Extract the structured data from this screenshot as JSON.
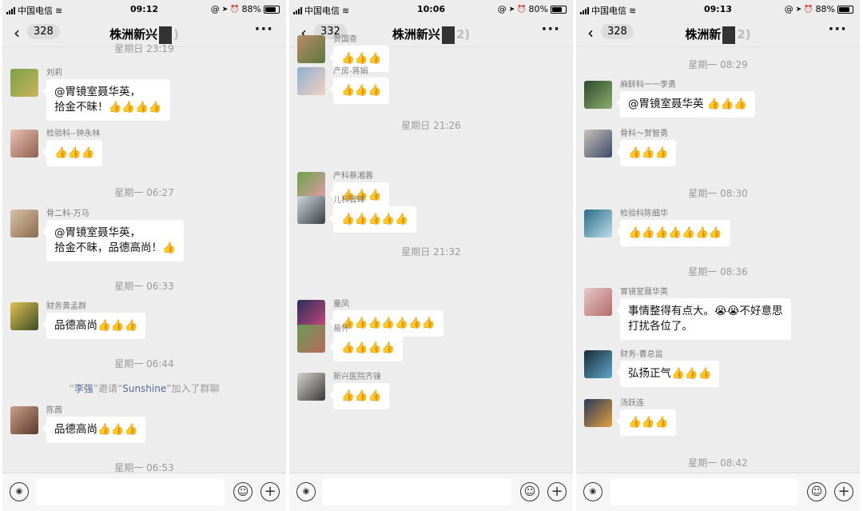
{
  "colors": {
    "background": "#ededed",
    "bubble": "#ffffff",
    "timestamp": "#9a9a9a",
    "link": "#576b95"
  },
  "panels": [
    {
      "status": {
        "carrier": "中国电信",
        "time": "09:12",
        "battery": "88%",
        "battery_level": 0.88
      },
      "nav": {
        "back_count": "328",
        "title": "株洲新兴",
        "title_tail": ")"
      },
      "items": [
        {
          "kind": "ts",
          "text": "星期日 23:19"
        },
        {
          "kind": "msg",
          "sender": "刘莉",
          "text": "@胃镜室聂华英，\n拾金不昧！👍👍👍👍",
          "avatar": [
            "#7aa049",
            "#c9b35a"
          ]
        },
        {
          "kind": "msg",
          "sender": "检验科--钟永林",
          "text": "👍👍👍",
          "avatar": [
            "#e9c1b5",
            "#8e5f4d"
          ]
        },
        {
          "kind": "ts",
          "text": "星期一 06:27"
        },
        {
          "kind": "msg",
          "sender": "骨二科-万马",
          "text": "@胃镜室聂华英，\n拾金不昧，品德高尚！👍",
          "avatar": [
            "#d8c2a8",
            "#8a6a4a"
          ]
        },
        {
          "kind": "ts",
          "text": "星期一 06:33"
        },
        {
          "kind": "msg",
          "sender": "财务黄孟群",
          "text": "品德高尚👍👍👍",
          "avatar": [
            "#e0c050",
            "#3d4d25"
          ]
        },
        {
          "kind": "ts",
          "text": "星期一 06:44"
        },
        {
          "kind": "sys",
          "q1": "“",
          "name1": "李强",
          "mid": "”邀请“",
          "name2": "Sunshine",
          "tail": "”加入了群聊"
        },
        {
          "kind": "msg",
          "sender": "陈茜",
          "text": "品德高尚👍👍👍",
          "avatar": [
            "#caa08a",
            "#5a3a2a"
          ]
        },
        {
          "kind": "ts",
          "text": "星期一 06:53"
        }
      ]
    },
    {
      "status": {
        "carrier": "中国电信",
        "time": "10:06",
        "battery": "80%",
        "battery_level": 0.8
      },
      "nav": {
        "back_count": "332",
        "title": "株洲新兴",
        "title_tail": "2)"
      },
      "items": [
        {
          "kind": "msg",
          "sender": "贺国查",
          "text": "👍👍👍",
          "avatar": [
            "#b88b6a",
            "#5b7a3a"
          ]
        },
        {
          "kind": "msg",
          "sender": "产房-蒋娟",
          "text": "👍👍👍",
          "avatar": [
            "#8fb0cf",
            "#f2d1c2"
          ]
        },
        {
          "kind": "ts",
          "text": "星期日 21:26"
        },
        {
          "kind": "msg",
          "sender": "产科蔡湘蓉",
          "text": "👍👍👍",
          "avatar": [
            "#6aa34a",
            "#e59aa9"
          ]
        },
        {
          "kind": "msg",
          "sender": "儿科曾晖",
          "text": "👍👍👍👍👍",
          "avatar": [
            "#cfd8df",
            "#3a3f44"
          ]
        },
        {
          "kind": "ts",
          "text": "星期日 21:32"
        },
        {
          "kind": "msg",
          "sender": "童凤",
          "text": "👍👍👍👍👍👍👍",
          "avatar": [
            "#2b2d5a",
            "#c44a7a"
          ]
        },
        {
          "kind": "msg",
          "sender": "易怀",
          "text": "👍👍👍👍",
          "avatar": [
            "#6c9a5a",
            "#b36a5a"
          ]
        },
        {
          "kind": "msg",
          "sender": "新兴医院齐锋",
          "text": "👍👍👍",
          "avatar": [
            "#d7d4cf",
            "#3a3a3a"
          ]
        }
      ]
    },
    {
      "status": {
        "carrier": "中国电信",
        "time": "09:13",
        "battery": "88%",
        "battery_level": 0.88
      },
      "nav": {
        "back_count": "328",
        "title": "株洲新",
        "title_tail": "2)"
      },
      "items": [
        {
          "kind": "ts",
          "text": "星期一 08:29"
        },
        {
          "kind": "msg",
          "sender": "麻醉科一一李勇",
          "text": "@胃镜室聂华英 👍👍👍",
          "avatar": [
            "#2c4a2c",
            "#8cae6c"
          ]
        },
        {
          "kind": "msg",
          "sender": "骨科～贺智勇",
          "text": "👍👍👍",
          "avatar": [
            "#c7c2b8",
            "#3b4a6a"
          ]
        },
        {
          "kind": "ts",
          "text": "星期一 08:30"
        },
        {
          "kind": "msg",
          "sender": "检验科陈细华",
          "text": "👍👍👍👍👍👍👍",
          "avatar": [
            "#2b6c8a",
            "#bcdde8"
          ]
        },
        {
          "kind": "ts",
          "text": "星期一 08:36"
        },
        {
          "kind": "msg",
          "sender": "胃镜室聂华英",
          "text": "事情整得有点大。😭😭不好意思\n打扰各位了。",
          "avatar": [
            "#e7c8c8",
            "#b56a6a"
          ]
        },
        {
          "kind": "msg",
          "sender": "财务-曹总监",
          "text": "弘扬正气👍👍👍",
          "avatar": [
            "#1a2a3a",
            "#5fa8c8"
          ]
        },
        {
          "kind": "msg",
          "sender": "汤跃连",
          "text": "👍👍👍",
          "avatar": [
            "#2a3a5a",
            "#e0a040"
          ]
        },
        {
          "kind": "ts",
          "text": "星期一 08:42"
        }
      ]
    }
  ]
}
